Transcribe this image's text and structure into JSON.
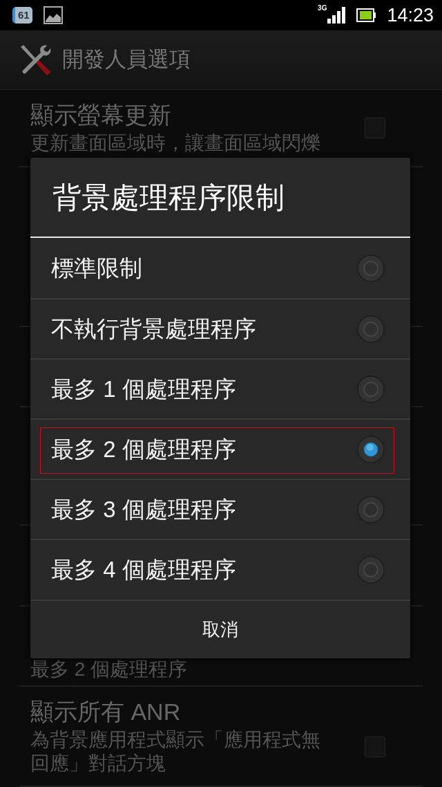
{
  "status_bar": {
    "notification_count": "61",
    "network": "3G",
    "time": "14:23"
  },
  "action_bar": {
    "title": "開發人員選項"
  },
  "preferences": [
    {
      "kind": "checkbox",
      "title": "顯示螢幕更新",
      "summary": "更新畫面區域時，讓畫面區域閃爍",
      "checked": false
    },
    {
      "kind": "summary",
      "summary": "最多 2 個處理程序"
    },
    {
      "kind": "checkbox",
      "title": "顯示所有 ANR",
      "summary": "為背景應用程式顯示「應用程式無回應」對話方塊",
      "checked": false
    }
  ],
  "dialog": {
    "title": "背景處理程序限制",
    "options": [
      {
        "label": "標準限制",
        "selected": false,
        "highlighted": false
      },
      {
        "label": "不執行背景處理程序",
        "selected": false,
        "highlighted": false
      },
      {
        "label": "最多 1 個處理程序",
        "selected": false,
        "highlighted": false
      },
      {
        "label": "最多 2 個處理程序",
        "selected": true,
        "highlighted": true
      },
      {
        "label": "最多 3 個處理程序",
        "selected": false,
        "highlighted": false
      },
      {
        "label": "最多 4 個處理程序",
        "selected": false,
        "highlighted": false
      }
    ],
    "cancel": "取消"
  }
}
